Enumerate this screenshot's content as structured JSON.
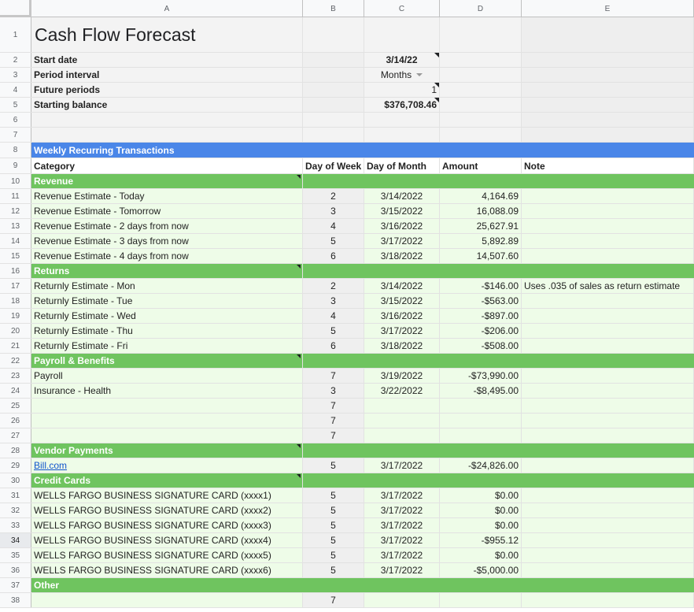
{
  "columns": [
    "A",
    "B",
    "C",
    "D",
    "E"
  ],
  "title": "Cash Flow Forecast",
  "settings": {
    "start_date_label": "Start date",
    "start_date_value": "3/14/22",
    "period_interval_label": "Period interval",
    "period_interval_value": "Months",
    "future_periods_label": "Future periods",
    "future_periods_value": "1",
    "starting_balance_label": "Starting balance",
    "starting_balance_value": "$376,708.46"
  },
  "section_title": "Weekly Recurring Transactions",
  "headers": {
    "category": "Category",
    "day_of_week": "Day of Week",
    "day_of_month": "Day of Month",
    "amount": "Amount",
    "note": "Note"
  },
  "groups": {
    "revenue": "Revenue",
    "returns": "Returns",
    "payroll": "Payroll & Benefits",
    "vendor": "Vendor Payments",
    "credit": "Credit Cards",
    "other": "Other"
  },
  "revenue_rows": [
    {
      "n": "11",
      "cat": "Revenue Estimate - Today",
      "dow": "2",
      "dom": "3/14/2022",
      "amt": "4,164.69",
      "note": ""
    },
    {
      "n": "12",
      "cat": "Revenue Estimate - Tomorrow",
      "dow": "3",
      "dom": "3/15/2022",
      "amt": "16,088.09",
      "note": ""
    },
    {
      "n": "13",
      "cat": "Revenue Estimate - 2 days from now",
      "dow": "4",
      "dom": "3/16/2022",
      "amt": "25,627.91",
      "note": ""
    },
    {
      "n": "14",
      "cat": "Revenue Estimate - 3 days from now",
      "dow": "5",
      "dom": "3/17/2022",
      "amt": "5,892.89",
      "note": ""
    },
    {
      "n": "15",
      "cat": "Revenue Estimate - 4 days from now",
      "dow": "6",
      "dom": "3/18/2022",
      "amt": "14,507.60",
      "note": ""
    }
  ],
  "returns_rows": [
    {
      "n": "17",
      "cat": "Returnly Estimate - Mon",
      "dow": "2",
      "dom": "3/14/2022",
      "amt": "-$146.00",
      "note": "Uses .035 of sales as return estimate"
    },
    {
      "n": "18",
      "cat": "Returnly Estimate - Tue",
      "dow": "3",
      "dom": "3/15/2022",
      "amt": "-$563.00",
      "note": ""
    },
    {
      "n": "19",
      "cat": "Returnly Estimate - Wed",
      "dow": "4",
      "dom": "3/16/2022",
      "amt": "-$897.00",
      "note": ""
    },
    {
      "n": "20",
      "cat": "Returnly Estimate - Thu",
      "dow": "5",
      "dom": "3/17/2022",
      "amt": "-$206.00",
      "note": ""
    },
    {
      "n": "21",
      "cat": "Returnly Estimate - Fri",
      "dow": "6",
      "dom": "3/18/2022",
      "amt": "-$508.00",
      "note": ""
    }
  ],
  "payroll_rows": [
    {
      "n": "23",
      "cat": "Payroll",
      "dow": "7",
      "dom": "3/19/2022",
      "amt": "-$73,990.00",
      "note": ""
    },
    {
      "n": "24",
      "cat": "Insurance - Health",
      "dow": "3",
      "dom": "3/22/2022",
      "amt": "-$8,495.00",
      "note": ""
    },
    {
      "n": "25",
      "cat": "",
      "dow": "7",
      "dom": "",
      "amt": "",
      "note": ""
    },
    {
      "n": "26",
      "cat": "",
      "dow": "7",
      "dom": "",
      "amt": "",
      "note": ""
    },
    {
      "n": "27",
      "cat": "",
      "dow": "7",
      "dom": "",
      "amt": "",
      "note": ""
    }
  ],
  "vendor_rows": [
    {
      "n": "29",
      "cat": "Bill.com",
      "dow": "5",
      "dom": "3/17/2022",
      "amt": "-$24,826.00",
      "note": ""
    }
  ],
  "credit_rows": [
    {
      "n": "31",
      "cat": "WELLS FARGO BUSINESS SIGNATURE CARD (xxxx1)",
      "dow": "5",
      "dom": "3/17/2022",
      "amt": "$0.00",
      "note": ""
    },
    {
      "n": "32",
      "cat": "WELLS FARGO BUSINESS SIGNATURE CARD (xxxx2)",
      "dow": "5",
      "dom": "3/17/2022",
      "amt": "$0.00",
      "note": ""
    },
    {
      "n": "33",
      "cat": "WELLS FARGO BUSINESS SIGNATURE CARD (xxxx3)",
      "dow": "5",
      "dom": "3/17/2022",
      "amt": "$0.00",
      "note": ""
    },
    {
      "n": "34",
      "cat": "WELLS FARGO BUSINESS SIGNATURE CARD (xxxx4)",
      "dow": "5",
      "dom": "3/17/2022",
      "amt": "-$955.12",
      "note": ""
    },
    {
      "n": "35",
      "cat": "WELLS FARGO BUSINESS SIGNATURE CARD (xxxx5)",
      "dow": "5",
      "dom": "3/17/2022",
      "amt": "$0.00",
      "note": ""
    },
    {
      "n": "36",
      "cat": "WELLS FARGO BUSINESS SIGNATURE CARD (xxxx6)",
      "dow": "5",
      "dom": "3/17/2022",
      "amt": "-$5,000.00",
      "note": ""
    }
  ],
  "other_rows": [
    {
      "n": "38",
      "cat": "",
      "dow": "7",
      "dom": "",
      "amt": "",
      "note": ""
    }
  ],
  "colors": {
    "section_blue": "#4a86e8",
    "group_green": "#6fc45f",
    "row_light_green": "#eefce8"
  }
}
